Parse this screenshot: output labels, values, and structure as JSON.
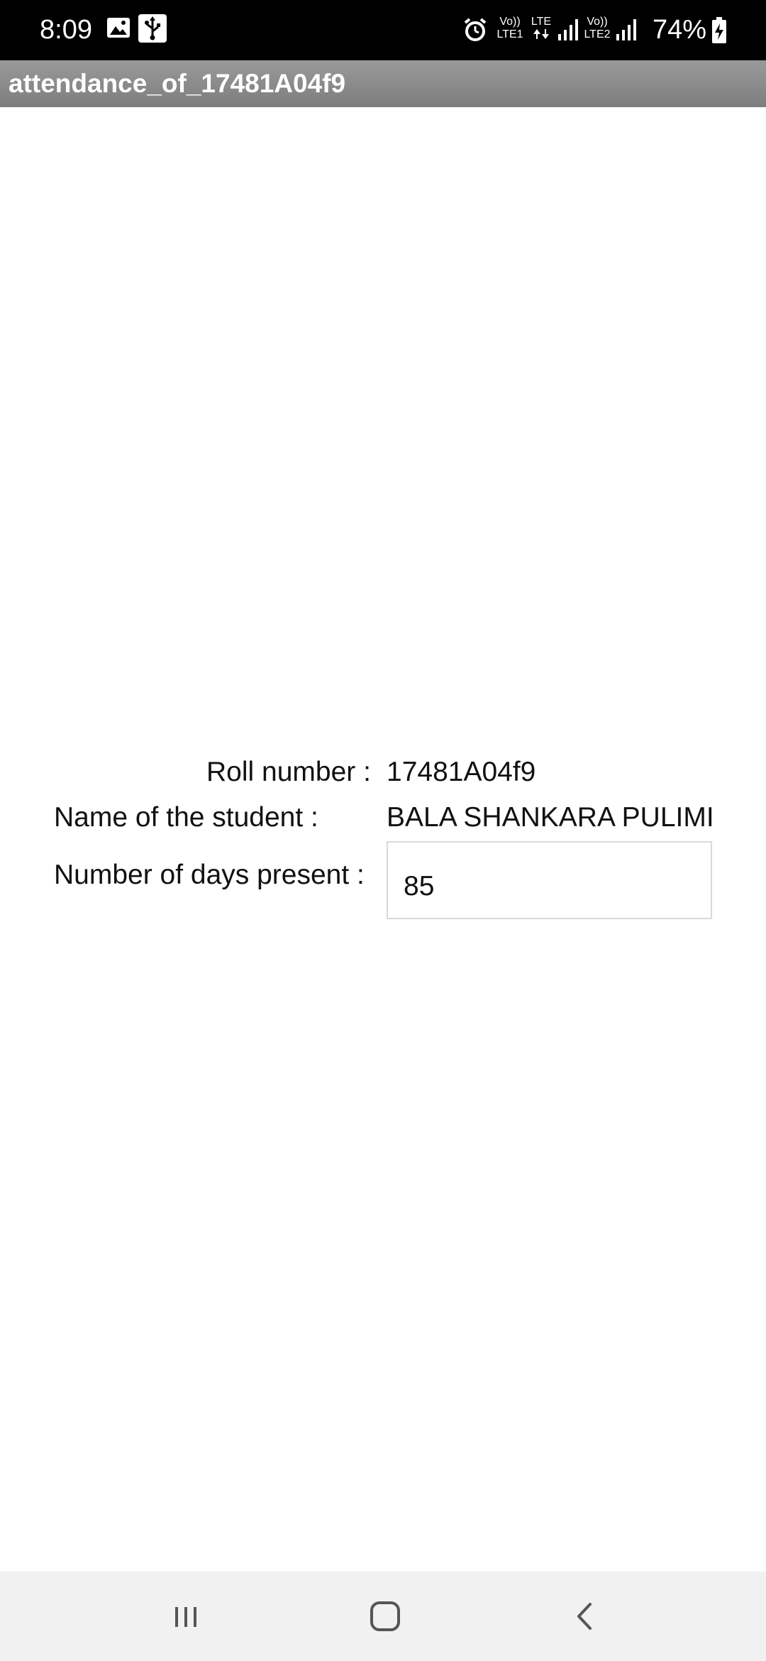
{
  "status_bar": {
    "time": "8:09",
    "battery": "74%",
    "icons": [
      "image-icon",
      "usb-icon",
      "alarm-icon",
      "volte-lte1-icon",
      "lte-data-icon",
      "signal-1-icon",
      "volte-lte2-icon",
      "signal-2-icon",
      "battery-charging-icon"
    ],
    "lte1_label_top": "Vo))",
    "lte1_label_bottom": "LTE1",
    "lte_label": "LTE",
    "lte2_label_top": "Vo))",
    "lte2_label_bottom": "LTE2"
  },
  "app": {
    "title": "attendance_of_17481A04f9"
  },
  "form": {
    "roll_label": "Roll number :",
    "roll_value": "17481A04f9",
    "name_label": "Name of the student :",
    "name_value": "BALA SHANKARA PULIMI",
    "days_label": "Number of days present :",
    "days_value": "85"
  },
  "nav_bar": {
    "icons": [
      "recent-apps-icon",
      "home-icon",
      "back-icon"
    ]
  },
  "colors": {
    "status_bar_bg": "#000000",
    "title_bar_bg": "#8a8a8a",
    "nav_bar_bg": "#f1f1f1",
    "text": "#111111"
  }
}
